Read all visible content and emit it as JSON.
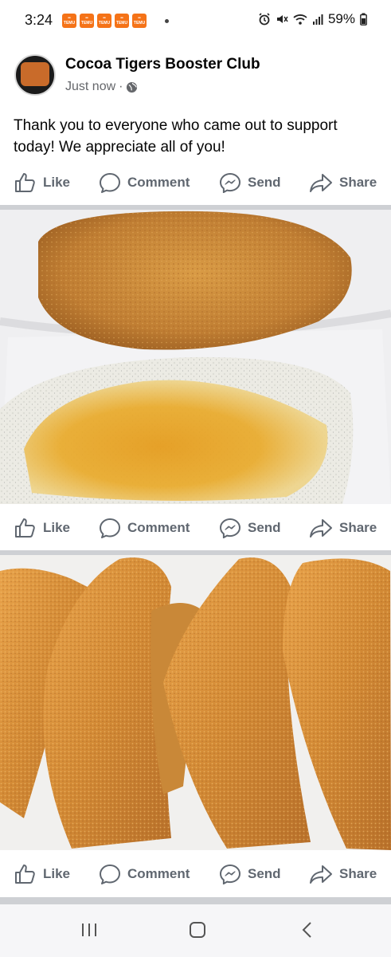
{
  "status_bar": {
    "time": "3:24",
    "notification_icon": "temu-icon",
    "notification_count": 5,
    "battery": "59%"
  },
  "post": {
    "page_name": "Cocoa Tigers Booster Club",
    "time": "Just now",
    "separator": "·",
    "privacy_icon": "globe-icon",
    "text": "Thank you to everyone who came out to support today! We appreciate all of you!"
  },
  "actions": {
    "like": "Like",
    "comment": "Comment",
    "send": "Send",
    "share": "Share"
  },
  "photos": [
    {
      "subject": "fried-fish-and-grits"
    },
    {
      "subject": "fried-fish-fillets"
    }
  ],
  "nav": {
    "recents_icon": "recents-icon",
    "home_icon": "home-icon",
    "back_icon": "back-icon"
  },
  "colors": {
    "action_gray": "#606770",
    "divider": "#ced0d4",
    "temu_orange": "#f57318"
  }
}
